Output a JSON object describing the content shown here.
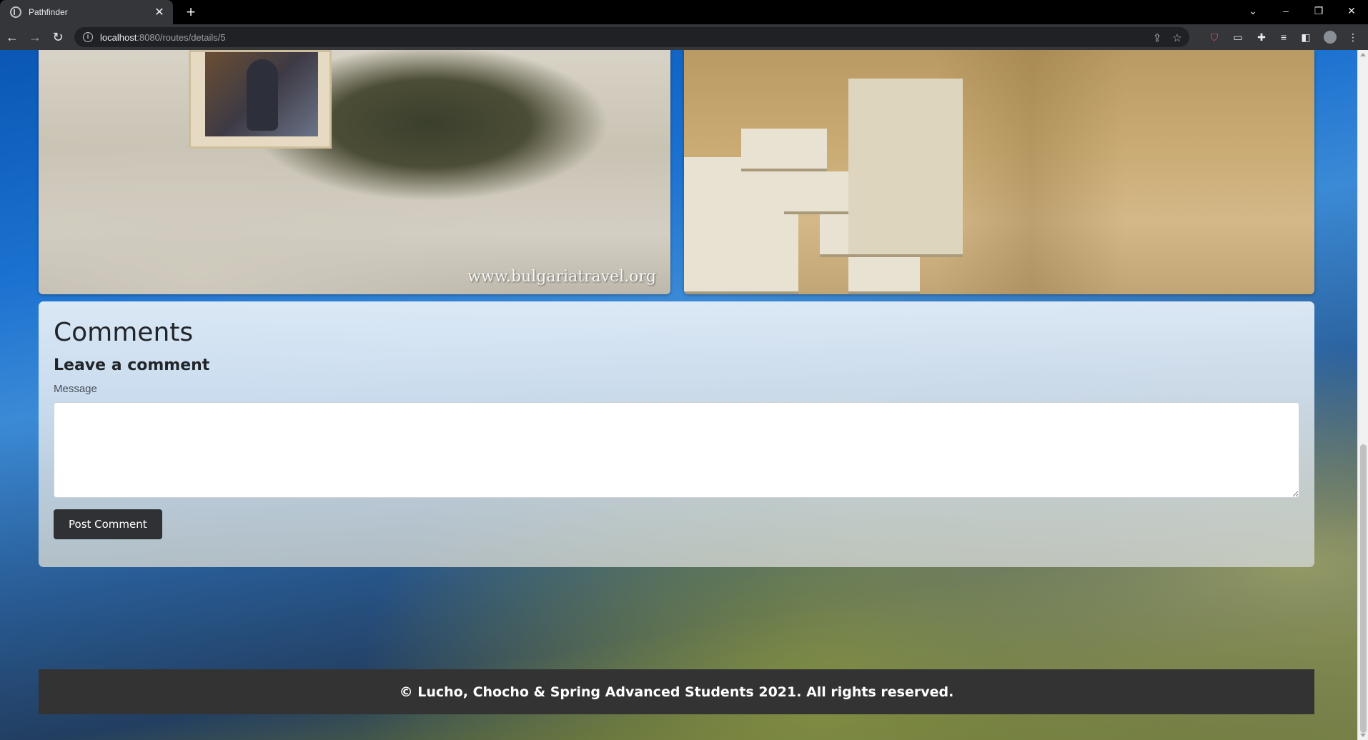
{
  "browser": {
    "tab_title": "Pathfinder",
    "tab_close_icon": "close-icon",
    "new_tab_label": "+",
    "url_host": "localhost",
    "url_rest": ":8080/routes/details/5",
    "window_controls": {
      "minimize": "–",
      "restore": "❐",
      "close": "✕",
      "tab_search": "⌄"
    },
    "nav": {
      "back": "←",
      "forward": "→",
      "reload": "↻"
    }
  },
  "gallery": {
    "images": [
      {
        "name": "cave-icon-photo",
        "watermark": "www.bulgariatravel.org"
      },
      {
        "name": "stone-stairs-photo"
      }
    ]
  },
  "comments": {
    "title": "Comments",
    "subtitle": "Leave a comment",
    "message_label": "Message",
    "message_value": "",
    "post_button": "Post Comment"
  },
  "footer": {
    "text": "© Lucho, Chocho & Spring Advanced Students 2021. All rights reserved."
  },
  "colors": {
    "button_bg": "#2f3134",
    "footer_bg": "#333333",
    "card_bg": "#e1eaf3"
  }
}
